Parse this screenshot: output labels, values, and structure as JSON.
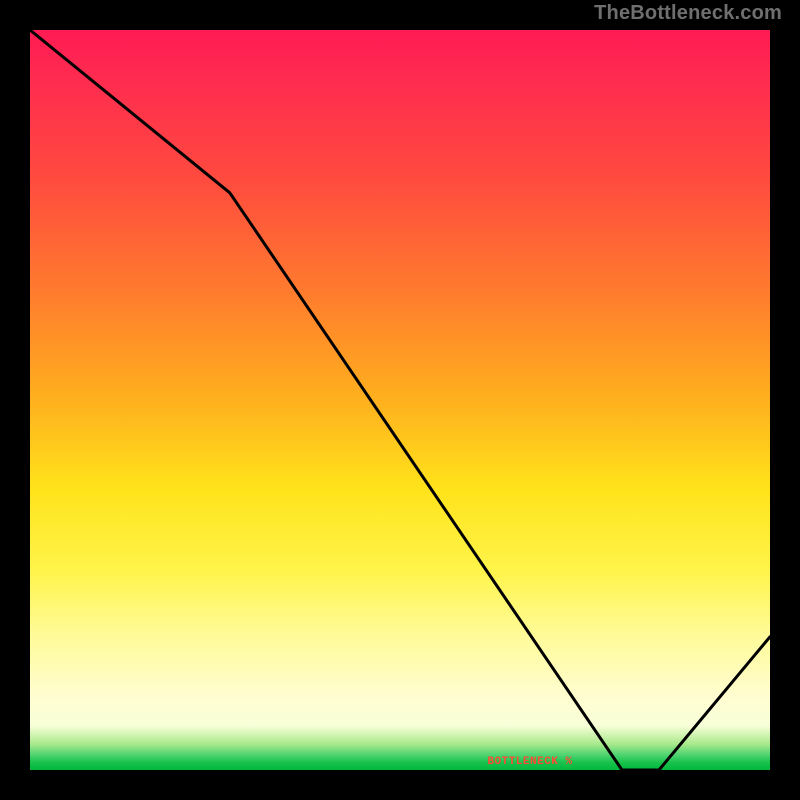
{
  "watermark": "TheBottleneck.com",
  "legend_label": "BOTTLENECK %",
  "chart_data": {
    "type": "line",
    "title": "",
    "xlabel": "",
    "ylabel": "",
    "xlim": [
      0,
      100
    ],
    "ylim": [
      0,
      100
    ],
    "series": [
      {
        "name": "bottleneck-percent",
        "x": [
          0,
          27,
          80,
          85,
          100
        ],
        "values": [
          100,
          78,
          0,
          0,
          18
        ]
      }
    ],
    "notes": "y ≈ bottleneck %; minimum (0) plateau near x≈80–85; rises again toward right edge. Background gradient encodes severity (red high → green low)."
  }
}
